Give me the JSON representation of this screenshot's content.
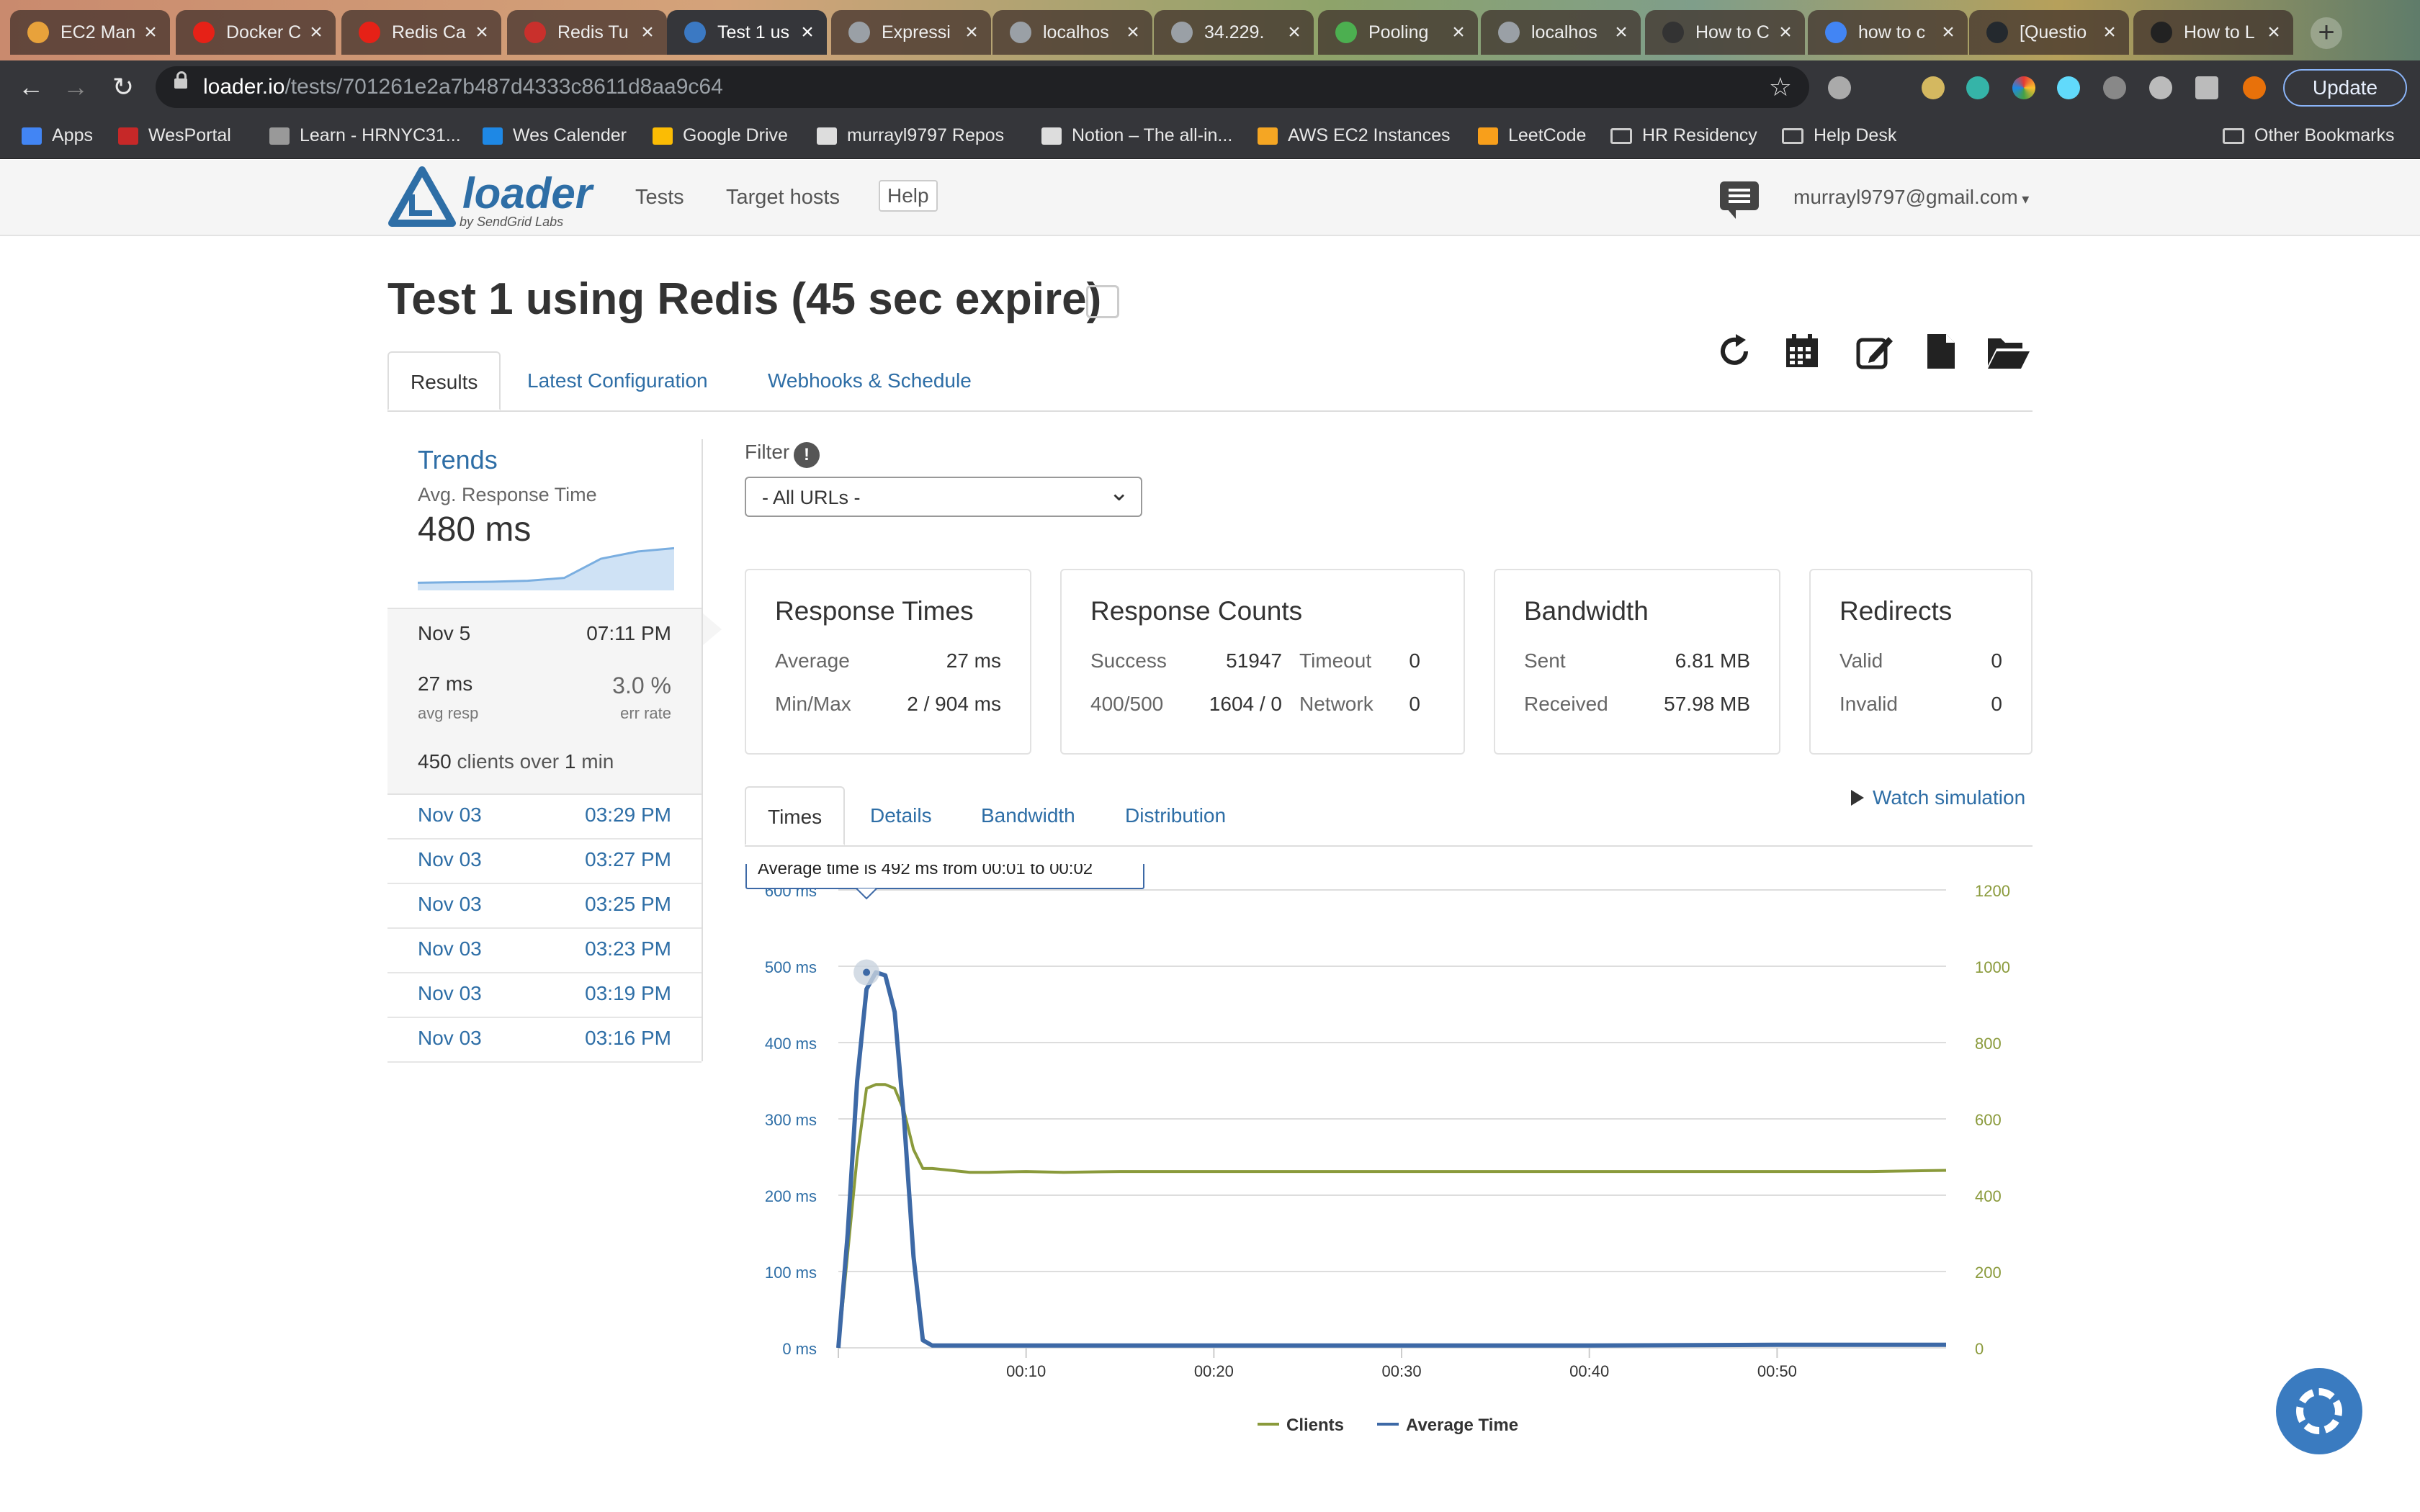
{
  "browser": {
    "tabs": [
      {
        "title": "EC2 Man",
        "color": "#e8a23b"
      },
      {
        "title": "Docker C",
        "color": "#e62117"
      },
      {
        "title": "Redis Ca",
        "color": "#e62117"
      },
      {
        "title": "Redis Tu",
        "color": "#c9302c"
      },
      {
        "title": "Test 1 us",
        "color": "#3b79c3",
        "active": true
      },
      {
        "title": "Expressi",
        "color": "#9aa0a6"
      },
      {
        "title": "localhos",
        "color": "#9aa0a6"
      },
      {
        "title": "34.229.",
        "color": "#9aa0a6"
      },
      {
        "title": "Pooling",
        "color": "#4caf50"
      },
      {
        "title": "localhos",
        "color": "#9aa0a6"
      },
      {
        "title": "How to C",
        "color": "#333333"
      },
      {
        "title": "how to c",
        "color": "#4285f4"
      },
      {
        "title": "[Questio",
        "color": "#24292e"
      },
      {
        "title": "How to L",
        "color": "#222222"
      }
    ],
    "url_host": "loader.io",
    "url_path": "/tests/701261e2a7b487d4333c8611d8aa9c64",
    "update_label": "Update",
    "bookmarks": [
      "Apps",
      "WesPortal",
      "Learn - HRNYC31...",
      "Wes Calender",
      "Google Drive",
      "murrayl9797 Repos",
      "Notion – The all-in...",
      "AWS EC2 Instances",
      "LeetCode",
      "HR Residency",
      "Help Desk"
    ],
    "other_bookmarks": "Other Bookmarks"
  },
  "site": {
    "logo_word": "loader",
    "logo_by": "by SendGrid Labs",
    "nav": [
      "Tests",
      "Target hosts",
      "Help"
    ],
    "user_email": "murrayl9797@gmail.com"
  },
  "page": {
    "title": "Test 1 using Redis (45 sec expire)",
    "tabs": [
      "Results",
      "Latest Configuration",
      "Webhooks & Schedule"
    ]
  },
  "sidebar": {
    "trends_title": "Trends",
    "trends_sub": "Avg. Response Time",
    "trends_value": "480 ms",
    "spark": [
      480,
      481,
      482,
      484,
      490,
      530,
      545,
      552
    ],
    "current": {
      "date": "Nov 5",
      "time": "07:11 PM",
      "avg_resp": "27 ms",
      "avg_resp_label": "avg resp",
      "err_rate": "3.0 %",
      "err_rate_label": "err rate",
      "clients": "450",
      "clients_mid": "clients over",
      "duration": "1",
      "duration_unit": "min"
    },
    "history": [
      {
        "date": "Nov 03",
        "time": "03:29 PM"
      },
      {
        "date": "Nov 03",
        "time": "03:27 PM"
      },
      {
        "date": "Nov 03",
        "time": "03:25 PM"
      },
      {
        "date": "Nov 03",
        "time": "03:23 PM"
      },
      {
        "date": "Nov 03",
        "time": "03:19 PM"
      },
      {
        "date": "Nov 03",
        "time": "03:16 PM"
      }
    ]
  },
  "filter": {
    "label": "Filter",
    "info": "!",
    "selected": "- All URLs -"
  },
  "cards": {
    "response_times": {
      "title": "Response Times",
      "avg_label": "Average",
      "avg": "27 ms",
      "minmax_label": "Min/Max",
      "minmax": "2 / 904 ms"
    },
    "response_counts": {
      "title": "Response Counts",
      "success_label": "Success",
      "success": "51947",
      "timeout_label": "Timeout",
      "timeout": "0",
      "err_label": "400/500",
      "err": "1604 / 0",
      "network_label": "Network",
      "network": "0"
    },
    "bandwidth": {
      "title": "Bandwidth",
      "sent_label": "Sent",
      "sent": "6.81 MB",
      "received_label": "Received",
      "received": "57.98 MB"
    },
    "redirects": {
      "title": "Redirects",
      "valid_label": "Valid",
      "valid": "0",
      "invalid_label": "Invalid",
      "invalid": "0"
    }
  },
  "chart_tabs": [
    "Times",
    "Details",
    "Bandwidth",
    "Distribution"
  ],
  "watch_simulation": "Watch simulation",
  "chart_data": {
    "type": "line",
    "x_ticks": [
      "00:10",
      "00:20",
      "00:30",
      "00:40",
      "00:50"
    ],
    "y_left_ticks": [
      "0 ms",
      "100 ms",
      "200 ms",
      "300 ms",
      "400 ms",
      "500 ms",
      "600 ms"
    ],
    "y_right_ticks": [
      "0",
      "200",
      "400",
      "600",
      "800",
      "1000",
      "1200"
    ],
    "ylim_left": [
      0,
      600
    ],
    "ylim_right": [
      0,
      1200
    ],
    "xlim": [
      0,
      59
    ],
    "colors": {
      "clients": "#8a9a3b",
      "avg": "#3d69a6"
    },
    "tooltip": "Average time is 492 ms from 00:01 to 00:02",
    "series": [
      {
        "name": "Clients",
        "axis": "right",
        "color": "#8a9a3b",
        "x": [
          0,
          1,
          1.5,
          2,
          2.5,
          3,
          3.5,
          4,
          4.5,
          5,
          6,
          7,
          8,
          10,
          12,
          15,
          20,
          25,
          30,
          35,
          40,
          45,
          50,
          55,
          59
        ],
        "values": [
          0,
          500,
          680,
          690,
          690,
          680,
          620,
          520,
          470,
          470,
          465,
          460,
          460,
          462,
          460,
          462,
          462,
          462,
          462,
          462,
          462,
          462,
          462,
          462,
          465
        ]
      },
      {
        "name": "Average Time",
        "axis": "left",
        "color": "#3d69a6",
        "x": [
          0,
          0.5,
          1,
          1.5,
          2,
          2.5,
          3,
          3.5,
          4,
          4.5,
          5,
          6,
          10,
          20,
          30,
          40,
          50,
          59
        ],
        "values": [
          0,
          150,
          350,
          470,
          492,
          488,
          440,
          300,
          120,
          10,
          3,
          3,
          3,
          3,
          3,
          3,
          4,
          4
        ]
      }
    ]
  }
}
